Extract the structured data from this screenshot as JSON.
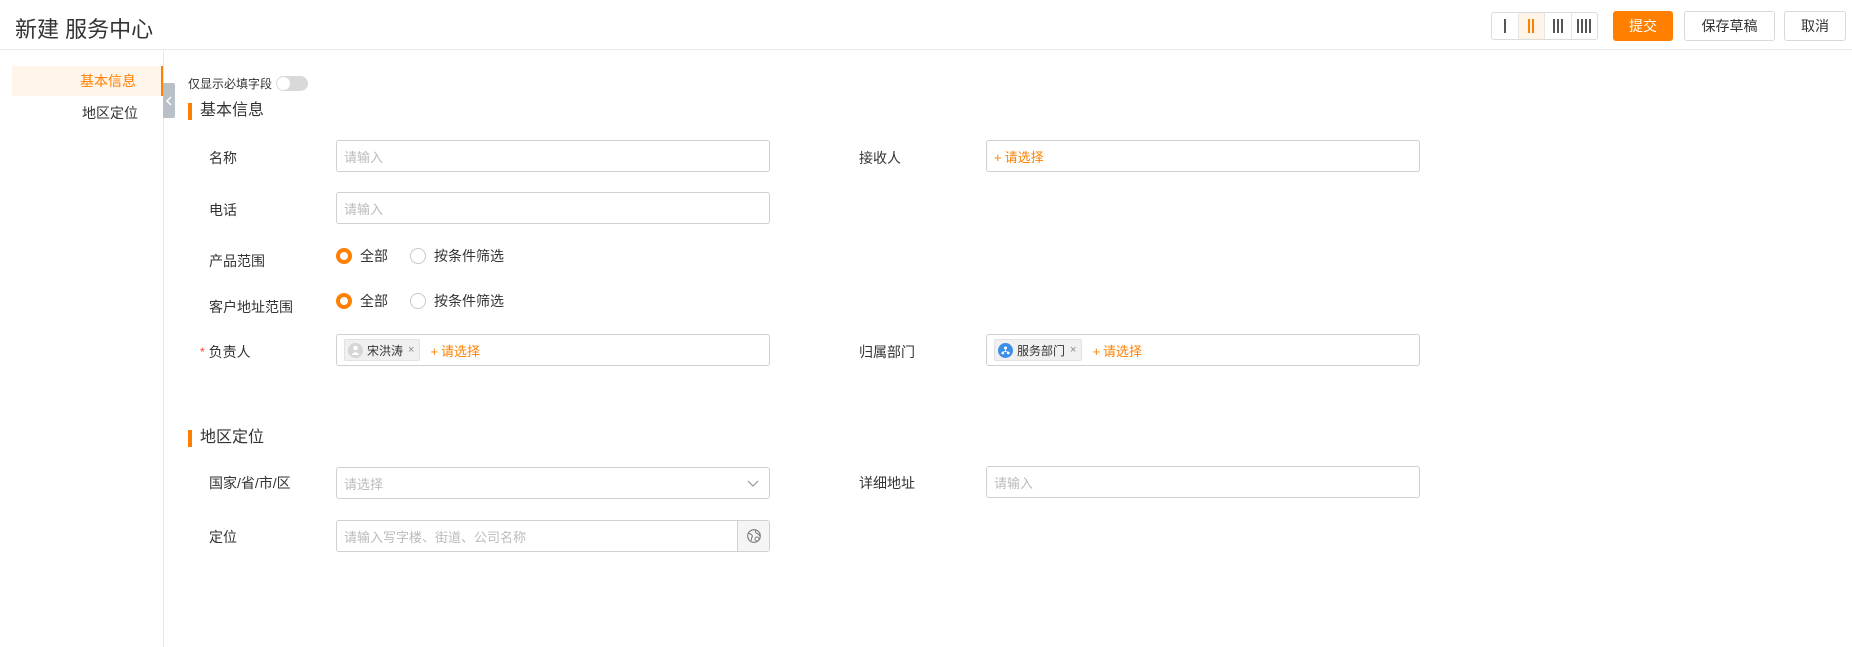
{
  "header": {
    "title": "新建 服务中心",
    "layout_options": [
      "Ⅰ",
      "Ⅱ",
      "Ⅲ",
      "Ⅳ"
    ],
    "submit_label": "提交",
    "draft_label": "保存草稿",
    "cancel_label": "取消"
  },
  "sidebar": {
    "items": [
      {
        "label": "基本信息",
        "active": true
      },
      {
        "label": "地区定位",
        "active": false
      }
    ],
    "collapse_icon": "chevron-left-icon"
  },
  "form": {
    "required_only_label": "仅显示必填字段",
    "sections": [
      {
        "title": "基本信息"
      },
      {
        "title": "地区定位"
      }
    ],
    "fields": {
      "name": {
        "label": "名称",
        "placeholder": "请输入",
        "value": ""
      },
      "receiver": {
        "label": "接收人",
        "picker": "请选择"
      },
      "phone": {
        "label": "电话",
        "placeholder": "请输入",
        "value": ""
      },
      "product_scope": {
        "label": "产品范围",
        "options": [
          "全部",
          "按条件筛选"
        ],
        "selected": "全部"
      },
      "customer_scope": {
        "label": "客户地址范围",
        "options": [
          "全部",
          "按条件筛选"
        ],
        "selected": "全部"
      },
      "owner": {
        "label": "负责人",
        "required": "*",
        "tag": "宋洪涛",
        "tag_close": "×",
        "picker": "请选择"
      },
      "department": {
        "label": "归属部门",
        "tag": "服务部门",
        "tag_close": "×",
        "picker": "请选择"
      },
      "region": {
        "label": "国家/省/市/区",
        "placeholder": "请选择"
      },
      "address": {
        "label": "详细地址",
        "placeholder": "请输入"
      },
      "location": {
        "label": "定位",
        "placeholder": "请输入写字楼、街道、公司名称"
      }
    },
    "picker_plus": "+"
  },
  "colors": {
    "accent": "#ff8000",
    "required": "#ff3b30"
  }
}
